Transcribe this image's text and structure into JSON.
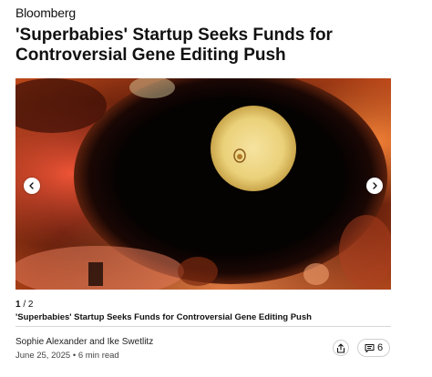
{
  "header": {
    "brand": "Bloomberg",
    "headline": "'Superbabies' Startup Seeks Funds for Controversial Gene Editing Push"
  },
  "gallery": {
    "current": "1",
    "separator": " / ",
    "total": "2",
    "caption": "'Superbabies' Startup Seeks Funds for Controversial Gene Editing Push",
    "prev_icon": "chevron-left-icon",
    "next_icon": "chevron-right-icon"
  },
  "byline": {
    "authors": "Sophie Alexander and Ike Swetlitz",
    "dateline": "June 25, 2025 • 6 min read"
  },
  "actions": {
    "share_icon": "share-icon",
    "comments_icon": "comment-icon",
    "comments_count": "6"
  },
  "colors": {
    "text": "#111111",
    "divider": "#d6d6d6",
    "photo_glow": "#f2d98a"
  }
}
